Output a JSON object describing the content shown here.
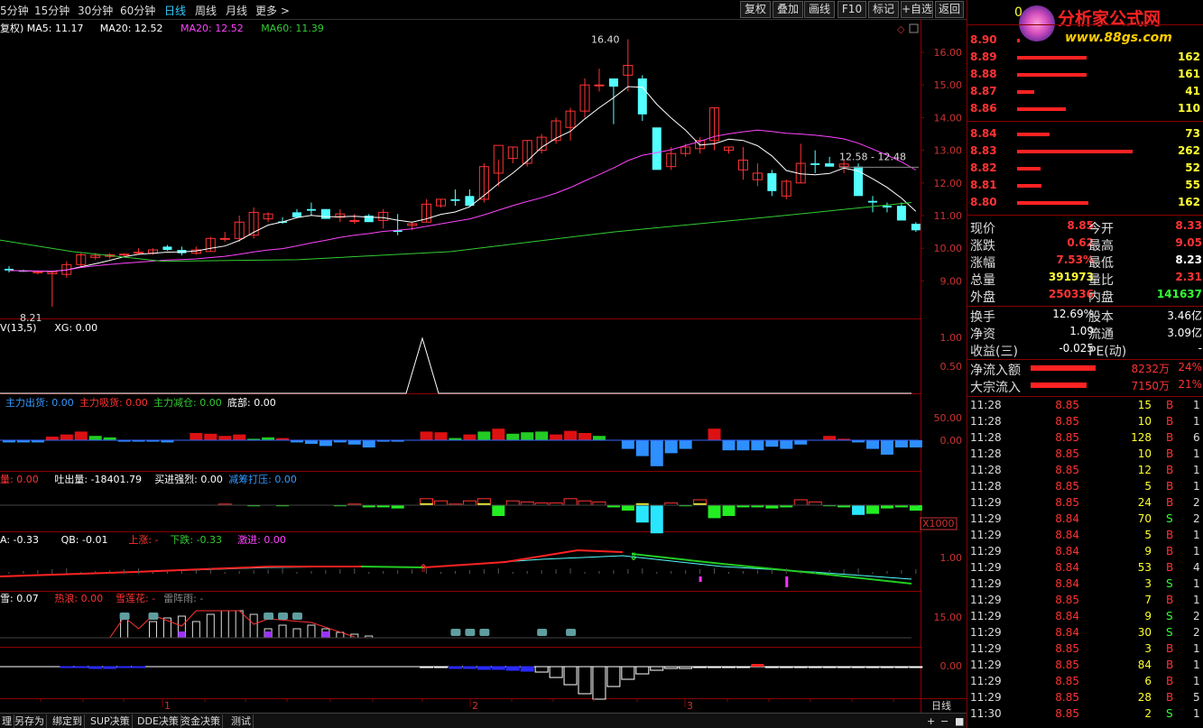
{
  "toolbar": {
    "periods": [
      "5分钟",
      "15分钟",
      "30分钟",
      "60分钟",
      "日线",
      "周线",
      "月线",
      "更多 >"
    ],
    "active_period": "日线",
    "buttons": [
      "复权",
      "叠加",
      "画线",
      "F10",
      "标记",
      "+自选",
      "返回"
    ]
  },
  "main_panel": {
    "legend": [
      {
        "text": "复权) MA5: 11.17",
        "color": "#ffffff"
      },
      {
        "text": "MA20: 12.52",
        "color": "#ffffff"
      },
      {
        "text": "MA20: 12.52",
        "color": "#ff44ff"
      },
      {
        "text": "MA60: 11.39",
        "color": "#33cc33"
      }
    ],
    "y_ticks": [
      "16.00",
      "15.00",
      "14.00",
      "13.00",
      "12.00",
      "11.00",
      "10.00",
      "9.00"
    ],
    "high_label": "16.40",
    "low_label": "8.21",
    "range_label": "12.58 - 12.48"
  },
  "panel2": {
    "legend": [
      {
        "text": "V(13,5)",
        "color": "#ffffff"
      },
      {
        "text": "XG: 0.00",
        "color": "#ffffff"
      }
    ],
    "y_ticks": [
      "1.00",
      "0.50"
    ]
  },
  "panel3": {
    "legend": [
      {
        "text": "主力出货: 0.00",
        "color": "#3399ff"
      },
      {
        "text": "主力吸货: 0.00",
        "color": "#ff3333"
      },
      {
        "text": "主力减仓: 0.00",
        "color": "#33cc33"
      },
      {
        "text": "底部: 0.00",
        "color": "#ffffff"
      }
    ],
    "y_ticks": [
      "50.00",
      "0.00"
    ]
  },
  "panel4": {
    "legend": [
      {
        "text": "量: 0.00",
        "color": "#ff3333"
      },
      {
        "text": "吐出量: -18401.79",
        "color": "#ffffff"
      },
      {
        "text": "买进强烈: 0.00",
        "color": "#ffffff"
      },
      {
        "text": "减筹打压: 0.00",
        "color": "#3399ff"
      }
    ],
    "unit_label": "X1000"
  },
  "panel5": {
    "legend": [
      {
        "text": "A: -0.33",
        "color": "#ffffff"
      },
      {
        "text": "QB: -0.01",
        "color": "#ffffff"
      },
      {
        "text": "上涨: -",
        "color": "#ff3333"
      },
      {
        "text": "下跌: -0.33",
        "color": "#33cc33"
      },
      {
        "text": "激进: 0.00",
        "color": "#ff44ff"
      }
    ],
    "y_ticks": [
      "1.00"
    ]
  },
  "panel6": {
    "legend": [
      {
        "text": "雪: 0.07",
        "color": "#ffffff"
      },
      {
        "text": "热浪: 0.00",
        "color": "#ff3333"
      },
      {
        "text": "雪莲花: -",
        "color": "#ff3333"
      },
      {
        "text": "雷阵雨: -",
        "color": "#888888"
      }
    ],
    "y_ticks": [
      "15.00"
    ]
  },
  "panel7": {
    "y_ticks": [
      "0.00"
    ]
  },
  "x_axis": {
    "labels": [
      "1",
      "2",
      "3"
    ],
    "period_label": "日线"
  },
  "bottom_tabs": [
    "理",
    "另存为",
    "绑定到",
    "SUP决策",
    "DDE决策",
    "资金决策",
    "测试"
  ],
  "right_panel": {
    "logo_text": "分析家公式网",
    "logo_url": "www.88gs.com",
    "top_price_prefix": "0",
    "sell_orders": [
      {
        "price": "8.90",
        "vol": "",
        "bar": 0.02
      },
      {
        "price": "8.89",
        "vol": "162",
        "bar": 0.6
      },
      {
        "price": "8.88",
        "vol": "161",
        "bar": 0.6
      },
      {
        "price": "8.87",
        "vol": "41",
        "bar": 0.15
      },
      {
        "price": "8.86",
        "vol": "110",
        "bar": 0.42
      }
    ],
    "buy_orders": [
      {
        "price": "8.84",
        "vol": "73",
        "bar": 0.28
      },
      {
        "price": "8.83",
        "vol": "262",
        "bar": 1.0
      },
      {
        "price": "8.82",
        "vol": "52",
        "bar": 0.2
      },
      {
        "price": "8.81",
        "vol": "55",
        "bar": 0.21
      },
      {
        "price": "8.80",
        "vol": "162",
        "bar": 0.62
      }
    ],
    "quote": [
      {
        "l": "现价",
        "v": "8.85",
        "vc": "#ff3333",
        "l2": "今开",
        "v2": "8.33",
        "v2c": "#ff3333"
      },
      {
        "l": "涨跌",
        "v": "0.62",
        "vc": "#ff3333",
        "l2": "最高",
        "v2": "9.05",
        "v2c": "#ff3333"
      },
      {
        "l": "涨幅",
        "v": "7.53%",
        "vc": "#ff3333",
        "l2": "最低",
        "v2": "8.23",
        "v2c": "#ffffff"
      },
      {
        "l": "总量",
        "v": "391973",
        "vc": "#ffff33",
        "l2": "量比",
        "v2": "2.31",
        "v2c": "#ff3333"
      },
      {
        "l": "外盘",
        "v": "250336",
        "vc": "#ff3333",
        "l2": "内盘",
        "v2": "141637",
        "v2c": "#33ff33"
      }
    ],
    "stats": [
      {
        "l": "换手",
        "v": "12.69%",
        "l2": "股本",
        "v2": "3.46亿"
      },
      {
        "l": "净资",
        "v": "1.09",
        "l2": "流通",
        "v2": "3.09亿"
      },
      {
        "l": "收益(三)",
        "v": "-0.025",
        "l2": "PE(动)",
        "v2": "-"
      }
    ],
    "flows": [
      {
        "l": "净流入额",
        "v": "8232万",
        "p": "24%",
        "bar": 0.9
      },
      {
        "l": "大宗流入",
        "v": "7150万",
        "p": "21%",
        "bar": 0.78
      }
    ],
    "trades": [
      {
        "t": "11:28",
        "p": "8.85",
        "v": "15",
        "s": "B",
        "n": "1"
      },
      {
        "t": "11:28",
        "p": "8.85",
        "v": "10",
        "s": "B",
        "n": "1"
      },
      {
        "t": "11:28",
        "p": "8.85",
        "v": "128",
        "s": "B",
        "n": "6"
      },
      {
        "t": "11:28",
        "p": "8.85",
        "v": "10",
        "s": "B",
        "n": "1"
      },
      {
        "t": "11:28",
        "p": "8.85",
        "v": "12",
        "s": "B",
        "n": "1"
      },
      {
        "t": "11:28",
        "p": "8.85",
        "v": "5",
        "s": "B",
        "n": "1"
      },
      {
        "t": "11:29",
        "p": "8.85",
        "v": "24",
        "s": "B",
        "n": "2"
      },
      {
        "t": "11:29",
        "p": "8.84",
        "v": "70",
        "s": "S",
        "n": "2"
      },
      {
        "t": "11:29",
        "p": "8.84",
        "v": "5",
        "s": "B",
        "n": "1"
      },
      {
        "t": "11:29",
        "p": "8.84",
        "v": "9",
        "s": "B",
        "n": "1"
      },
      {
        "t": "11:29",
        "p": "8.84",
        "v": "53",
        "s": "B",
        "n": "4"
      },
      {
        "t": "11:29",
        "p": "8.84",
        "v": "3",
        "s": "S",
        "n": "1"
      },
      {
        "t": "11:29",
        "p": "8.85",
        "v": "7",
        "s": "B",
        "n": "1"
      },
      {
        "t": "11:29",
        "p": "8.84",
        "v": "9",
        "s": "S",
        "n": "2"
      },
      {
        "t": "11:29",
        "p": "8.84",
        "v": "30",
        "s": "S",
        "n": "2"
      },
      {
        "t": "11:29",
        "p": "8.85",
        "v": "3",
        "s": "B",
        "n": "1"
      },
      {
        "t": "11:29",
        "p": "8.85",
        "v": "84",
        "s": "B",
        "n": "1"
      },
      {
        "t": "11:29",
        "p": "8.85",
        "v": "6",
        "s": "B",
        "n": "1"
      },
      {
        "t": "11:29",
        "p": "8.85",
        "v": "28",
        "s": "B",
        "n": "5"
      },
      {
        "t": "11:30",
        "p": "8.85",
        "v": "2",
        "s": "S",
        "n": "1"
      }
    ]
  },
  "candles": [
    [
      9.37,
      9.45,
      9.26,
      9.32
    ],
    [
      9.31,
      9.34,
      9.28,
      9.3
    ],
    [
      9.25,
      9.33,
      9.2,
      9.28
    ],
    [
      9.22,
      9.31,
      8.21,
      9.27
    ],
    [
      9.2,
      9.6,
      9.1,
      9.5
    ],
    [
      9.5,
      9.85,
      9.4,
      9.8
    ],
    [
      9.72,
      9.85,
      9.65,
      9.78
    ],
    [
      9.75,
      9.85,
      9.68,
      9.8
    ],
    [
      9.8,
      9.85,
      9.75,
      9.82
    ],
    [
      9.85,
      10,
      9.8,
      9.88
    ],
    [
      9.85,
      10,
      9.8,
      9.95
    ],
    [
      10.05,
      10.1,
      9.92,
      9.95
    ],
    [
      9.95,
      10.05,
      9.78,
      9.85
    ],
    [
      9.85,
      10.05,
      9.8,
      9.95
    ],
    [
      9.9,
      10.35,
      9.9,
      10.3
    ],
    [
      10.3,
      10.5,
      10.2,
      10.3
    ],
    [
      10.3,
      11.0,
      10.2,
      10.8
    ],
    [
      10.4,
      11.25,
      10.3,
      11.1
    ],
    [
      10.9,
      11.1,
      10.8,
      11.05
    ],
    [
      10.82,
      10.95,
      10.75,
      10.78
    ],
    [
      11.1,
      11.2,
      11,
      10.95
    ],
    [
      11.2,
      11.4,
      11.0,
      11.15
    ],
    [
      11.2,
      11.2,
      10.9,
      10.9
    ],
    [
      10.95,
      11.2,
      10.8,
      11.05
    ],
    [
      10.85,
      11.05,
      10.75,
      10.85
    ],
    [
      11.0,
      11.05,
      10.85,
      10.8
    ],
    [
      10.85,
      11.2,
      10.6,
      11.1
    ],
    [
      10.55,
      11.05,
      10.4,
      10.5
    ],
    [
      10.7,
      10.8,
      10.55,
      10.75
    ],
    [
      10.8,
      11.5,
      10.8,
      11.35
    ],
    [
      11.3,
      11.5,
      11.25,
      11.5
    ],
    [
      11.5,
      11.8,
      11.3,
      11.45
    ],
    [
      11.6,
      11.8,
      11.3,
      11.3
    ],
    [
      11.5,
      12.6,
      11.4,
      12.5
    ],
    [
      12.3,
      12.7,
      11.9,
      13.15
    ],
    [
      12.75,
      13.1,
      12.6,
      13.1
    ],
    [
      12.6,
      13.3,
      12.5,
      13.3
    ],
    [
      13.0,
      13.5,
      12.9,
      13.4
    ],
    [
      13.3,
      14.0,
      13.2,
      13.9
    ],
    [
      13.7,
      14.3,
      13.3,
      14.2
    ],
    [
      14.2,
      15.2,
      14.0,
      15.0
    ],
    [
      15.0,
      15.5,
      14.8,
      15.0
    ],
    [
      15.2,
      15.0,
      13.8,
      14.95
    ],
    [
      15.3,
      16.4,
      14.8,
      15.6
    ],
    [
      15.2,
      15.3,
      13.9,
      14.1
    ],
    [
      13.7,
      13.1,
      12.5,
      12.4
    ],
    [
      12.5,
      13.1,
      12.4,
      12.9
    ],
    [
      12.9,
      13.2,
      12.8,
      13.1
    ],
    [
      13.05,
      13.4,
      12.9,
      13.3
    ],
    [
      13.3,
      14.3,
      13.0,
      14.3
    ],
    [
      13.0,
      13.1,
      12.9,
      13.1
    ],
    [
      12.4,
      13.1,
      12.1,
      12.7
    ],
    [
      12.1,
      12.6,
      11.9,
      12.3
    ],
    [
      12.3,
      12.4,
      11.6,
      11.75
    ],
    [
      11.6,
      12.1,
      11.5,
      12.05
    ],
    [
      12.0,
      13.2,
      12.0,
      12.6
    ],
    [
      12.6,
      13.0,
      12.3,
      12.55
    ],
    [
      12.6,
      12.8,
      12.5,
      12.5
    ],
    [
      12.5,
      12.7,
      12.3,
      12.58
    ],
    [
      12.5,
      12.6,
      11.7,
      11.6
    ],
    [
      11.45,
      11.6,
      11.1,
      11.4
    ],
    [
      11.3,
      11.4,
      11.1,
      11.25
    ],
    [
      11.3,
      11.4,
      11.0,
      10.85
    ],
    [
      10.75,
      10.8,
      10.5,
      10.55
    ]
  ]
}
